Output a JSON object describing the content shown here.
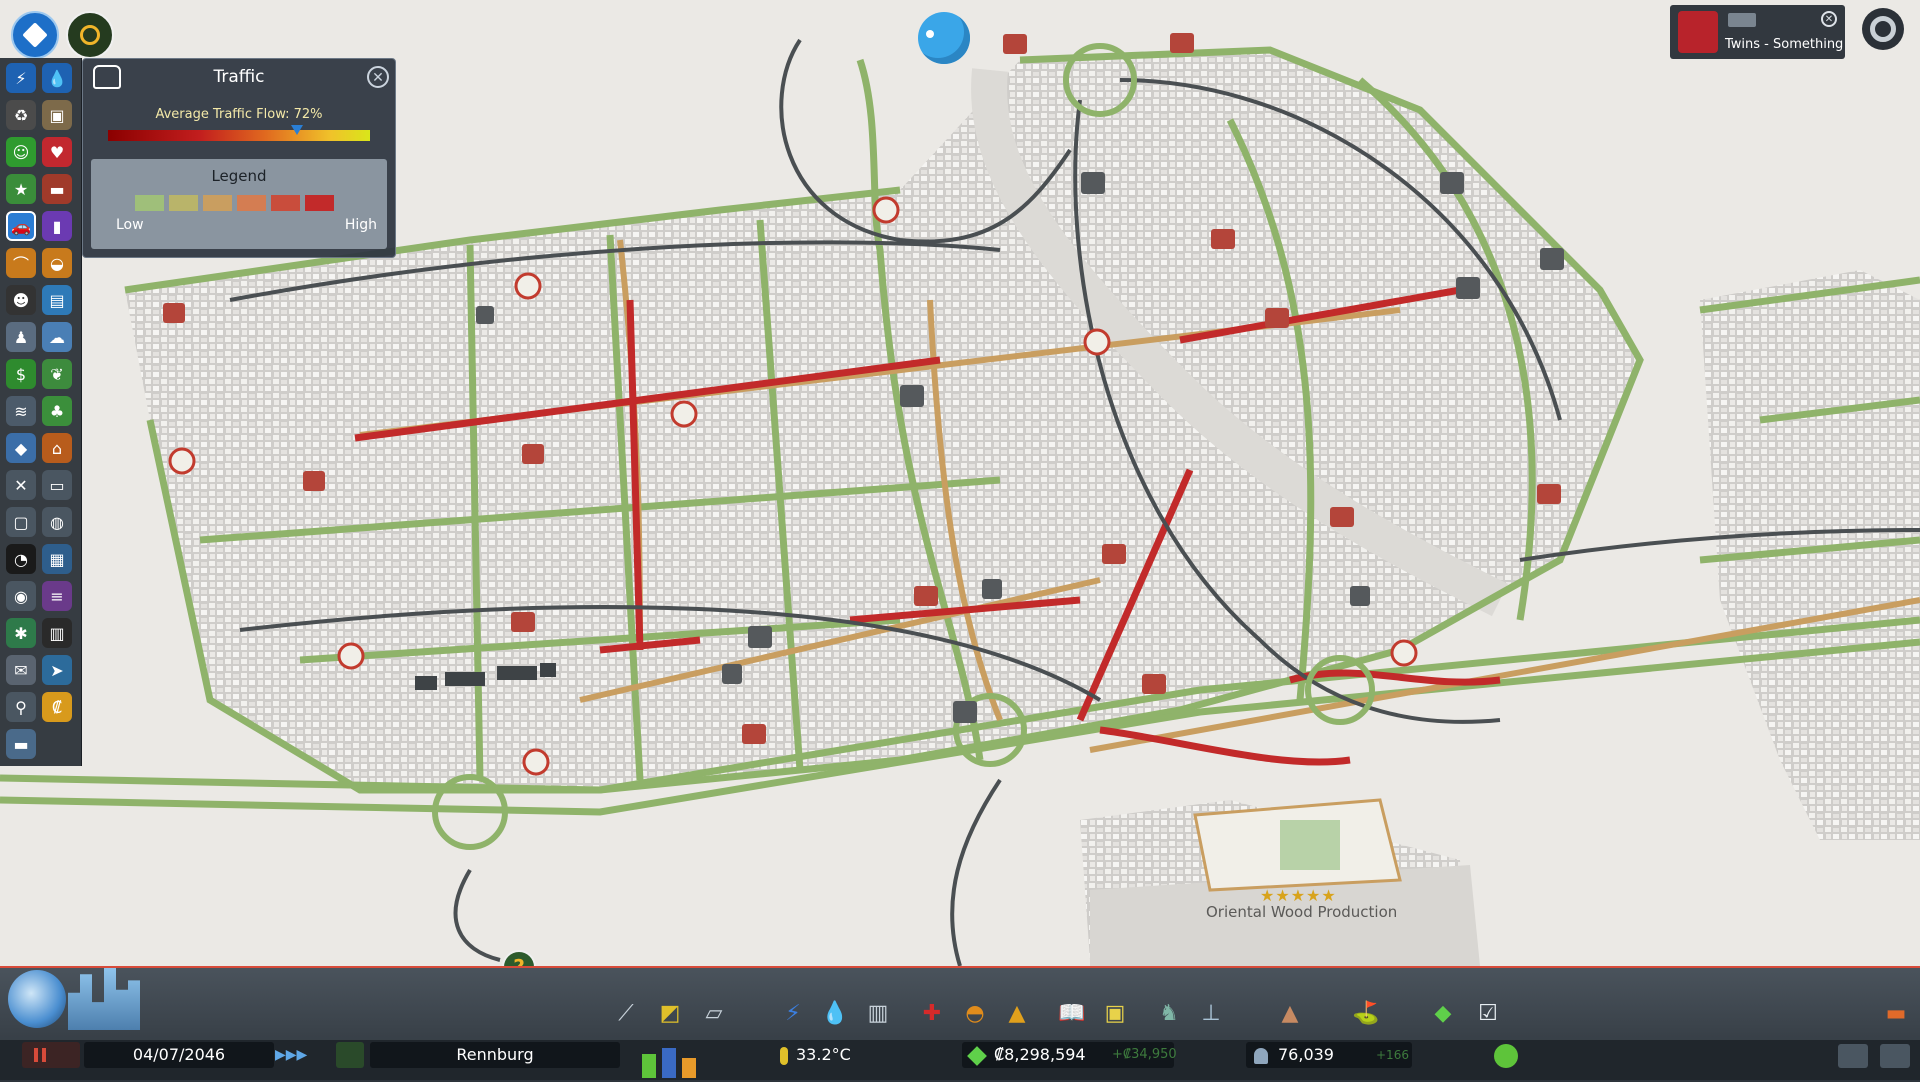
{
  "panel": {
    "title": "Traffic",
    "flow_label": "Average Traffic Flow: 72%",
    "flow_value": 0.72,
    "legend_title": "Legend",
    "legend_low": "Low",
    "legend_high": "High",
    "legend_colors": [
      "#9fbf7a",
      "#b9b46a",
      "#c99e60",
      "#d47d52",
      "#c94d3c",
      "#c22a2a"
    ]
  },
  "radio": {
    "song": "Twins - Something"
  },
  "map": {
    "building_name": "Oriental Wood Production",
    "building_stars": "★★★★★"
  },
  "bottom": {
    "date": "04/07/2046",
    "city": "Rennburg",
    "temperature": "33.2°C",
    "money": "₡8,298,594",
    "income": "+₡34,950",
    "population": "76,039",
    "pop_change": "+166"
  },
  "colors": {
    "accent_red": "#d84b3a",
    "road_green": "#8fb36a",
    "congestion_red": "#c22a2a"
  }
}
